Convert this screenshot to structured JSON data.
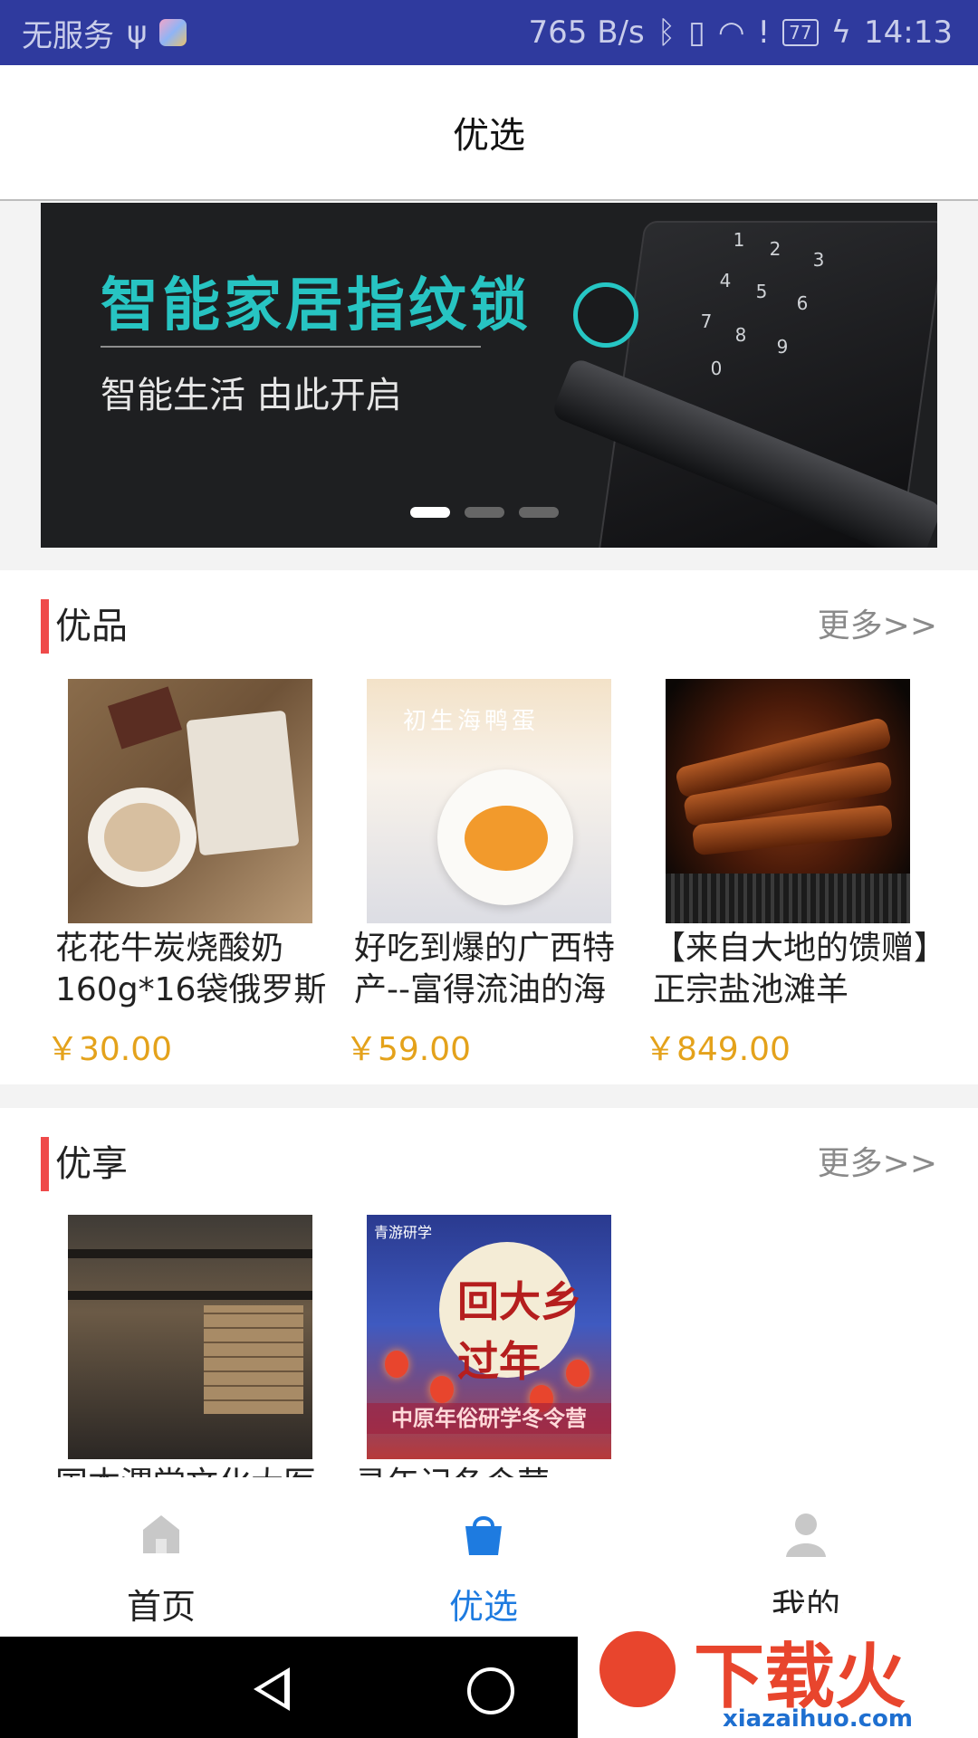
{
  "status_bar": {
    "carrier": "无服务",
    "net_speed": "765 B/s",
    "battery": "77",
    "time": "14:13"
  },
  "header": {
    "title": "优选"
  },
  "banner": {
    "headline": "智能家居指纹锁",
    "subtitle": "智能生活 由此开启",
    "lock_keys": [
      "1",
      "2",
      "3",
      "4",
      "5",
      "6",
      "7",
      "8",
      "9",
      "0"
    ],
    "active_slide": 1,
    "slide_count": 3
  },
  "sections": [
    {
      "title": "优品",
      "more": "更多>>",
      "products": [
        {
          "name": "花花牛炭烧酸奶160g*16袋俄罗斯",
          "price": "￥30.00"
        },
        {
          "name": "好吃到爆的广西特产--富得流油的海",
          "price": "￥59.00",
          "image_text": "初生海鸭蛋"
        },
        {
          "name": "【来自大地的馈赠】正宗盐池滩羊",
          "price": "￥849.00"
        }
      ]
    },
    {
      "title": "优享",
      "more": "更多>>",
      "products": [
        {
          "name": "国本渭堂文化大医",
          "price": ""
        },
        {
          "name": "寻年记冬令营",
          "price": "",
          "image_text": "回大乡过年",
          "image_banner": "中原年俗研学冬令营",
          "image_brand": "青游研学"
        }
      ]
    }
  ],
  "tab_bar": {
    "tabs": [
      {
        "label": "首页",
        "icon": "home-icon",
        "active": false
      },
      {
        "label": "优选",
        "icon": "shopping-bag-icon",
        "active": true
      },
      {
        "label": "我的",
        "icon": "user-icon",
        "active": false
      }
    ]
  },
  "watermark": {
    "text": "下载火",
    "url": "xiazaihuo.com"
  },
  "colors": {
    "status_bar": "#2f3a9e",
    "accent": "#1e7be0",
    "price": "#e4a21b",
    "section_marker": "#ef4a4a"
  }
}
